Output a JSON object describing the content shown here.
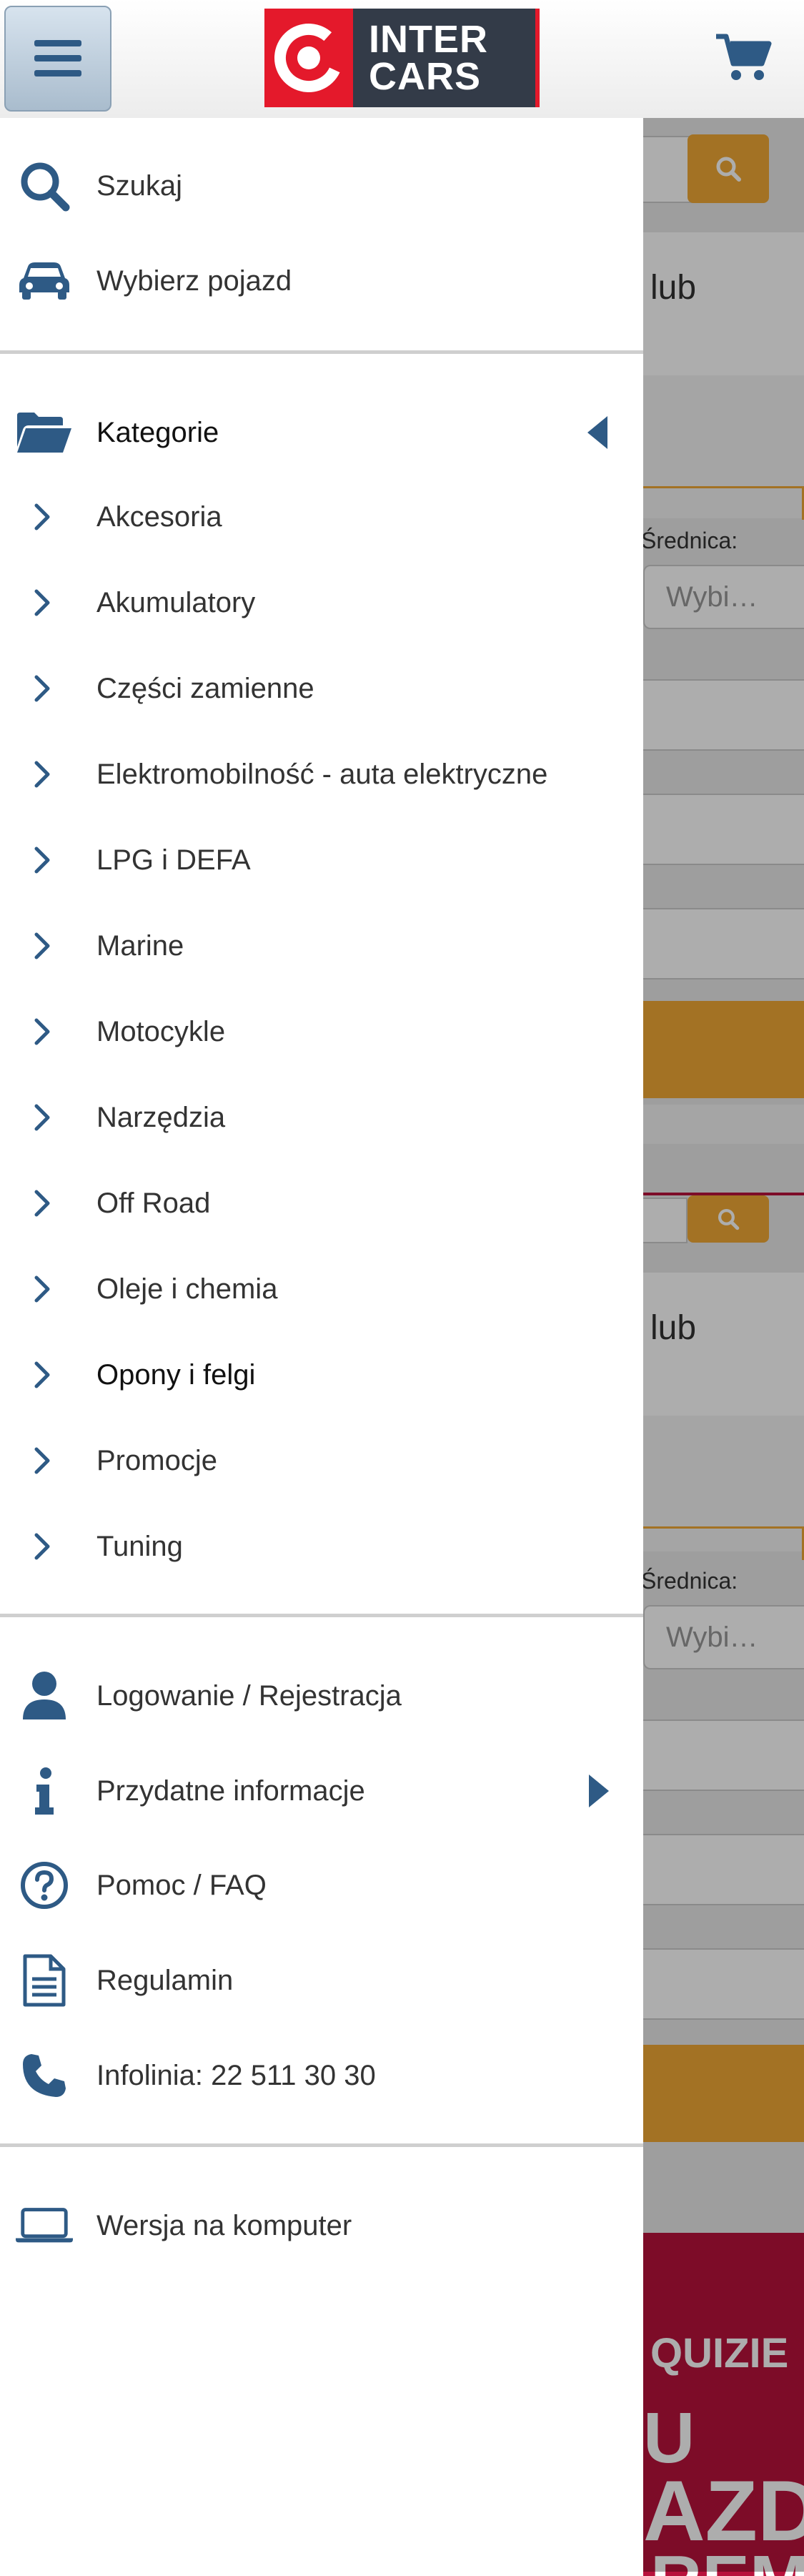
{
  "header": {
    "menu_icon": "hamburger-icon",
    "logo_line1": "INTER",
    "logo_line2": "CARS",
    "cart_icon": "cart-icon"
  },
  "drawer": {
    "top_items": [
      {
        "label": "Szukaj",
        "icon": "search-icon"
      },
      {
        "label": "Wybierz pojazd",
        "icon": "car-icon"
      }
    ],
    "categories": {
      "label": "Kategorie",
      "icon": "folder-open-icon",
      "items": [
        "Akcesoria",
        "Akumulatory",
        "Części zamienne",
        "Elektromobilność - auta elektryczne",
        "LPG i DEFA",
        "Marine",
        "Motocykle",
        "Narzędzia",
        "Off Road",
        "Oleje i chemia",
        "Opony i felgi",
        "Promocje",
        "Tuning"
      ]
    },
    "account_items": [
      {
        "label": "Logowanie / Rejestracja",
        "icon": "user-icon"
      },
      {
        "label": "Przydatne informacje",
        "icon": "info-icon"
      },
      {
        "label": "Pomoc / FAQ",
        "icon": "question-circle-icon"
      },
      {
        "label": "Regulamin",
        "icon": "document-icon"
      },
      {
        "label": "Infolinia: 22 511 30 30",
        "icon": "phone-icon"
      }
    ],
    "desktop_item": {
      "label": "Wersja na komputer",
      "icon": "laptop-icon"
    }
  },
  "background": {
    "heading_fragment": "lub",
    "diameter_label": "Średnica:",
    "select_placeholder": "Wybi…",
    "promo_line1": "QUIZIE",
    "promo_line2": "U",
    "promo_line3": "AZD",
    "promo_line4": "REM"
  },
  "colors": {
    "icon_blue": "#2e5a85",
    "brand_red": "#e4192b",
    "brand_dark": "#333b48",
    "accent_orange": "#f0a935"
  }
}
